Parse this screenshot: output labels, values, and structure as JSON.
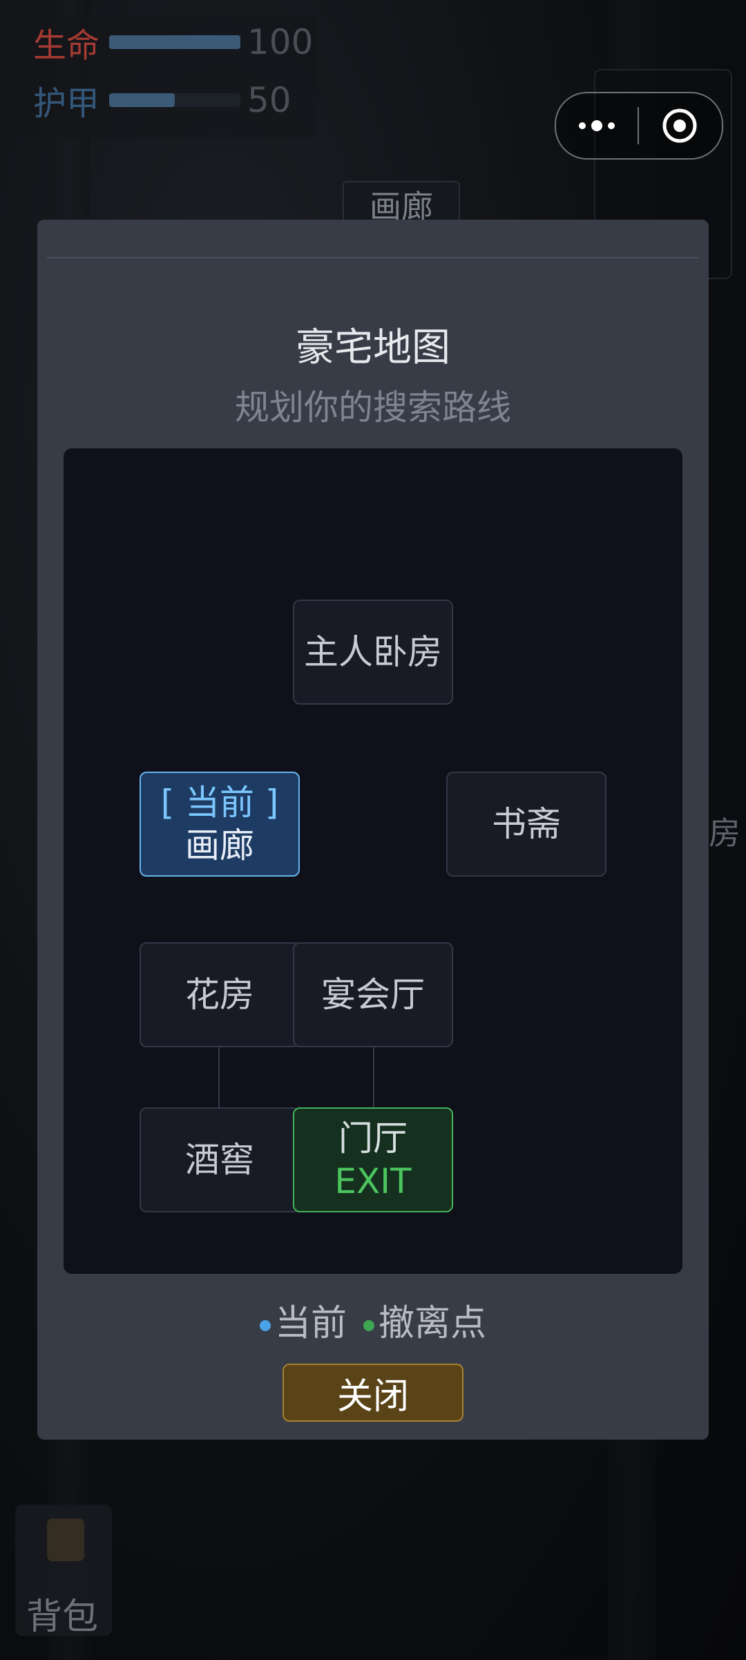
{
  "hud": {
    "health": {
      "label": "生命",
      "value": "100",
      "fill": 1.0,
      "color": "#a53a33"
    },
    "armor": {
      "label": "护甲",
      "value": "50",
      "fill": 0.5,
      "color": "#34587a"
    }
  },
  "background": {
    "room_label_top": "画廊",
    "room_label_right": "房",
    "backpack_label": "背包"
  },
  "map_modal": {
    "title": "豪宅地图",
    "subtitle": "规划你的搜索路线",
    "rooms": {
      "master_bedroom": {
        "label": "主人卧房"
      },
      "gallery": {
        "tag": "[ 当前 ]",
        "label": "画廊"
      },
      "study": {
        "label": "书斋"
      },
      "greenhouse": {
        "label": "花房"
      },
      "banquet_hall": {
        "label": "宴会厅"
      },
      "wine_cellar": {
        "label": "酒窖"
      },
      "foyer": {
        "label": "门厅",
        "tag": "EXIT"
      }
    },
    "legend": {
      "current": {
        "label": "当前",
        "color": "#4aa3e6"
      },
      "extraction": {
        "label": "撤离点",
        "color": "#3fa552"
      }
    },
    "close_label": "关闭"
  },
  "colors": {
    "accent_current": "#67b3ee",
    "accent_exit": "#45b35a",
    "close_button": "#5a4417"
  }
}
